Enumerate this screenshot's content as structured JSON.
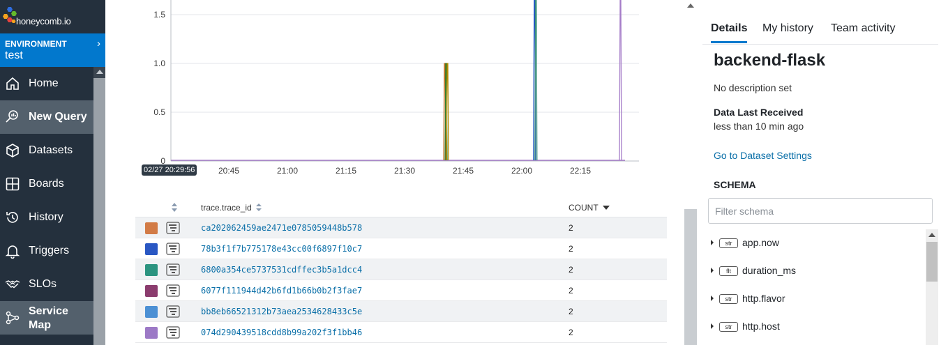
{
  "brand": {
    "wordmark": "honeycomb.io"
  },
  "environment": {
    "label": "ENVIRONMENT",
    "value": "test"
  },
  "nav": {
    "items": [
      {
        "label": "Home",
        "icon": "home-icon",
        "active": false
      },
      {
        "label": "New Query",
        "icon": "query-icon",
        "active": true
      },
      {
        "label": "Datasets",
        "icon": "cube-icon",
        "active": false
      },
      {
        "label": "Boards",
        "icon": "boards-icon",
        "active": false
      },
      {
        "label": "History",
        "icon": "history-icon",
        "active": false
      },
      {
        "label": "Triggers",
        "icon": "bell-icon",
        "active": false
      },
      {
        "label": "SLOs",
        "icon": "handshake-icon",
        "active": false
      },
      {
        "label": "Service Map",
        "icon": "service-map-icon",
        "active": true
      }
    ]
  },
  "chart_data": {
    "type": "line",
    "title": "",
    "xlabel": "",
    "ylabel": "",
    "y_ticks": [
      "1.5",
      "1.0",
      "0.5",
      "0"
    ],
    "x_ticks": [
      "20:45",
      "21:00",
      "21:15",
      "21:30",
      "21:45",
      "22:00",
      "22:15"
    ],
    "start_time_badge": "02/27 20:29:56",
    "grid": true,
    "note_peaks": [
      {
        "x": "21:40",
        "y": 1,
        "colors": [
          "#c2762a",
          "#2a7a2a",
          "#b38b00"
        ]
      },
      {
        "x": "22:03",
        "y": 2,
        "colors": [
          "#1f55c0",
          "#3a8f7a"
        ]
      },
      {
        "x": "22:25",
        "y": 2,
        "colors": [
          "#a57cc8"
        ]
      }
    ]
  },
  "table": {
    "headers": {
      "trace": "trace.trace_id",
      "count": "COUNT"
    },
    "rows": [
      {
        "color": "#d27b46",
        "trace_id": "ca202062459ae2471e0785059448b578",
        "count": "2"
      },
      {
        "color": "#2957c3",
        "trace_id": "78b3f1f7b775178e43cc00f6897f10c7",
        "count": "2"
      },
      {
        "color": "#2c9480",
        "trace_id": "6800a354ce5737531cdffec3b5a1dcc4",
        "count": "2"
      },
      {
        "color": "#8b3c6e",
        "trace_id": "6077f111944d42b6fd1b66b0b2f3fae7",
        "count": "2"
      },
      {
        "color": "#4c90d4",
        "trace_id": "bb8eb66521312b73aea2534628433c5e",
        "count": "2"
      },
      {
        "color": "#9c79c6",
        "trace_id": "074d290439518cdd8b99a202f3f1bb46",
        "count": "2"
      }
    ]
  },
  "side": {
    "tabs": [
      "Details",
      "My history",
      "Team activity"
    ],
    "dataset_name": "backend-flask",
    "description": "No description set",
    "data_last_received_label": "Data Last Received",
    "data_last_received_value": "less than 10 min ago",
    "settings_link": "Go to Dataset Settings",
    "schema_heading": "SCHEMA",
    "filter_placeholder": "Filter schema",
    "fields": [
      {
        "type": "str",
        "name": "app.now"
      },
      {
        "type": "flt",
        "name": "duration_ms"
      },
      {
        "type": "str",
        "name": "http.flavor"
      },
      {
        "type": "str",
        "name": "http.host"
      }
    ]
  }
}
